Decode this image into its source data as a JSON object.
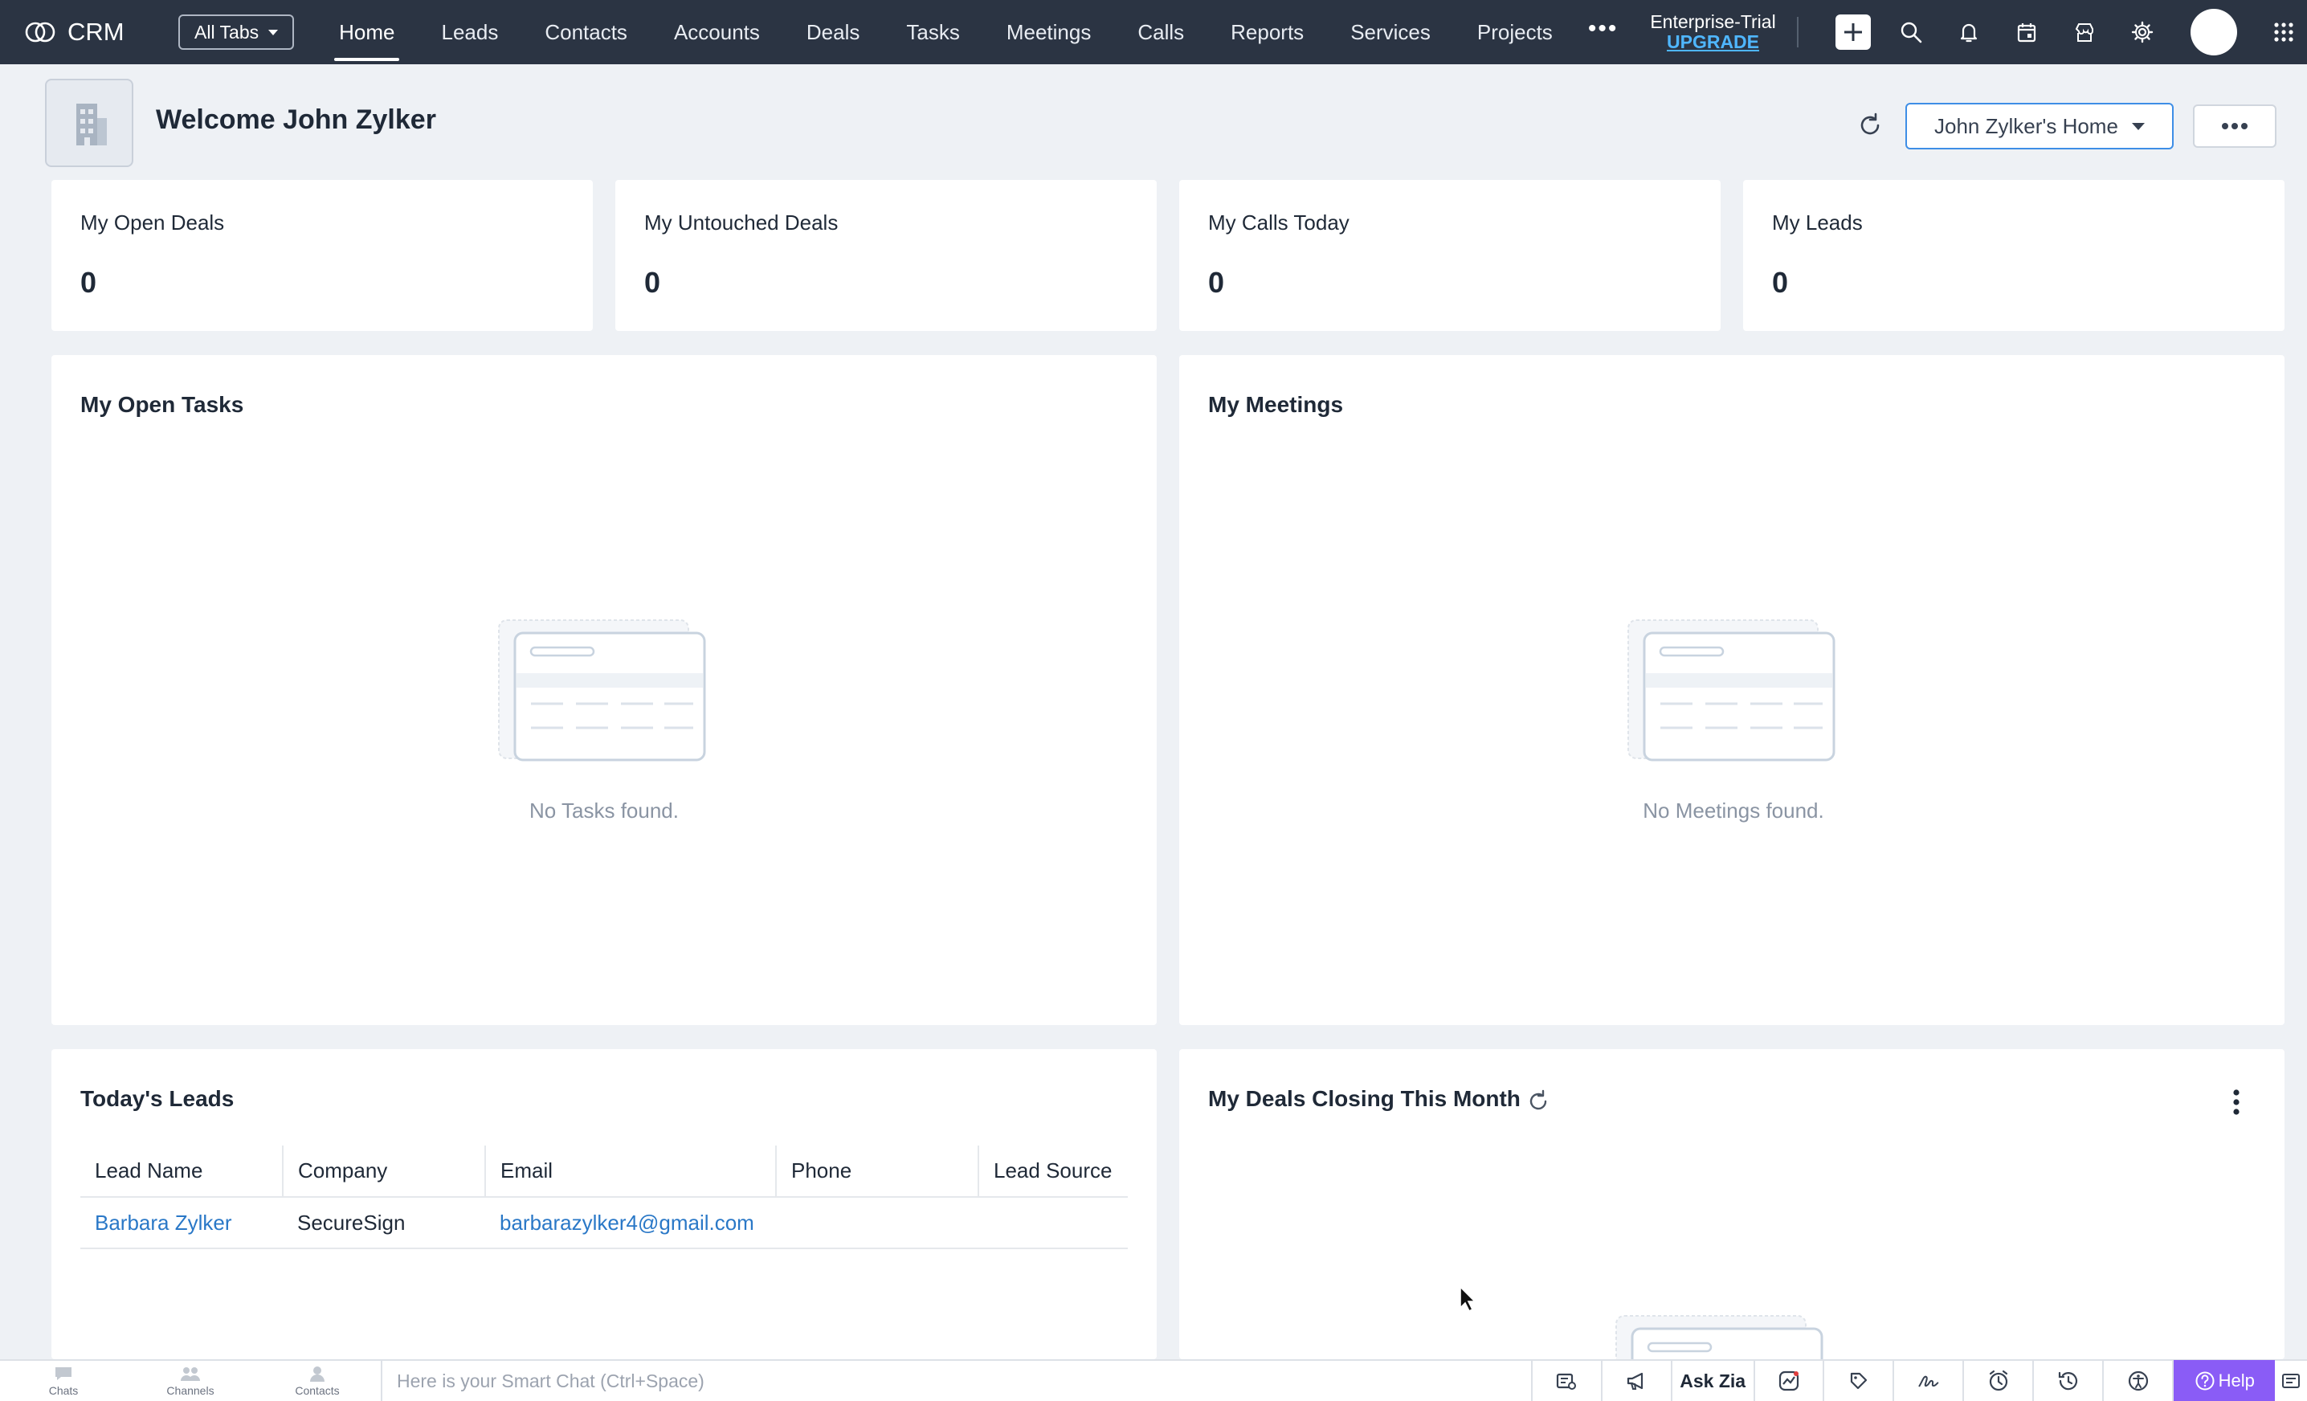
{
  "app": {
    "brand": "CRM",
    "all_tabs_label": "All Tabs",
    "tabs": [
      {
        "label": "Home",
        "active": true
      },
      {
        "label": "Leads"
      },
      {
        "label": "Contacts"
      },
      {
        "label": "Accounts"
      },
      {
        "label": "Deals"
      },
      {
        "label": "Tasks"
      },
      {
        "label": "Meetings"
      },
      {
        "label": "Calls"
      },
      {
        "label": "Reports"
      },
      {
        "label": "Services"
      },
      {
        "label": "Projects"
      }
    ],
    "more_tabs": "•••",
    "trial_label": "Enterprise-Trial",
    "upgrade_label": "UPGRADE",
    "icons": [
      "plus-icon",
      "search-icon",
      "bell-icon",
      "calendar-icon",
      "marketplace-icon",
      "gear-icon",
      "avatar",
      "app-grid-icon"
    ],
    "colors": {
      "nav_bg": "#2b3443",
      "accent": "#3e8ee6",
      "link": "#2a78c7",
      "help": "#8a5cf6"
    }
  },
  "header": {
    "welcome": "Welcome John Zylker",
    "home_view": "John Zylker's Home"
  },
  "kpis": [
    {
      "label": "My Open Deals",
      "value": "0"
    },
    {
      "label": "My Untouched Deals",
      "value": "0"
    },
    {
      "label": "My Calls Today",
      "value": "0"
    },
    {
      "label": "My Leads",
      "value": "0"
    }
  ],
  "panels": {
    "tasks": {
      "title": "My Open Tasks",
      "empty_text": "No Tasks found."
    },
    "meetings": {
      "title": "My Meetings",
      "empty_text": "No Meetings found."
    },
    "leads": {
      "title": "Today's Leads",
      "columns": [
        "Lead Name",
        "Company",
        "Email",
        "Phone",
        "Lead Source"
      ],
      "rows": [
        {
          "lead_name": "Barbara Zylker",
          "company": "SecureSign",
          "email": "barbarazylker4@gmail.com",
          "phone": "",
          "lead_source": ""
        }
      ]
    },
    "deals": {
      "title": "My Deals Closing This Month"
    }
  },
  "bottombar": {
    "items": [
      {
        "label": "Chats",
        "icon": "chat-icon"
      },
      {
        "label": "Channels",
        "icon": "channels-icon"
      },
      {
        "label": "Contacts",
        "icon": "contacts-icon"
      }
    ],
    "smartchat_placeholder": "Here is your Smart Chat (Ctrl+Space)",
    "ask_zia": "Ask Zia",
    "help": "Help"
  }
}
